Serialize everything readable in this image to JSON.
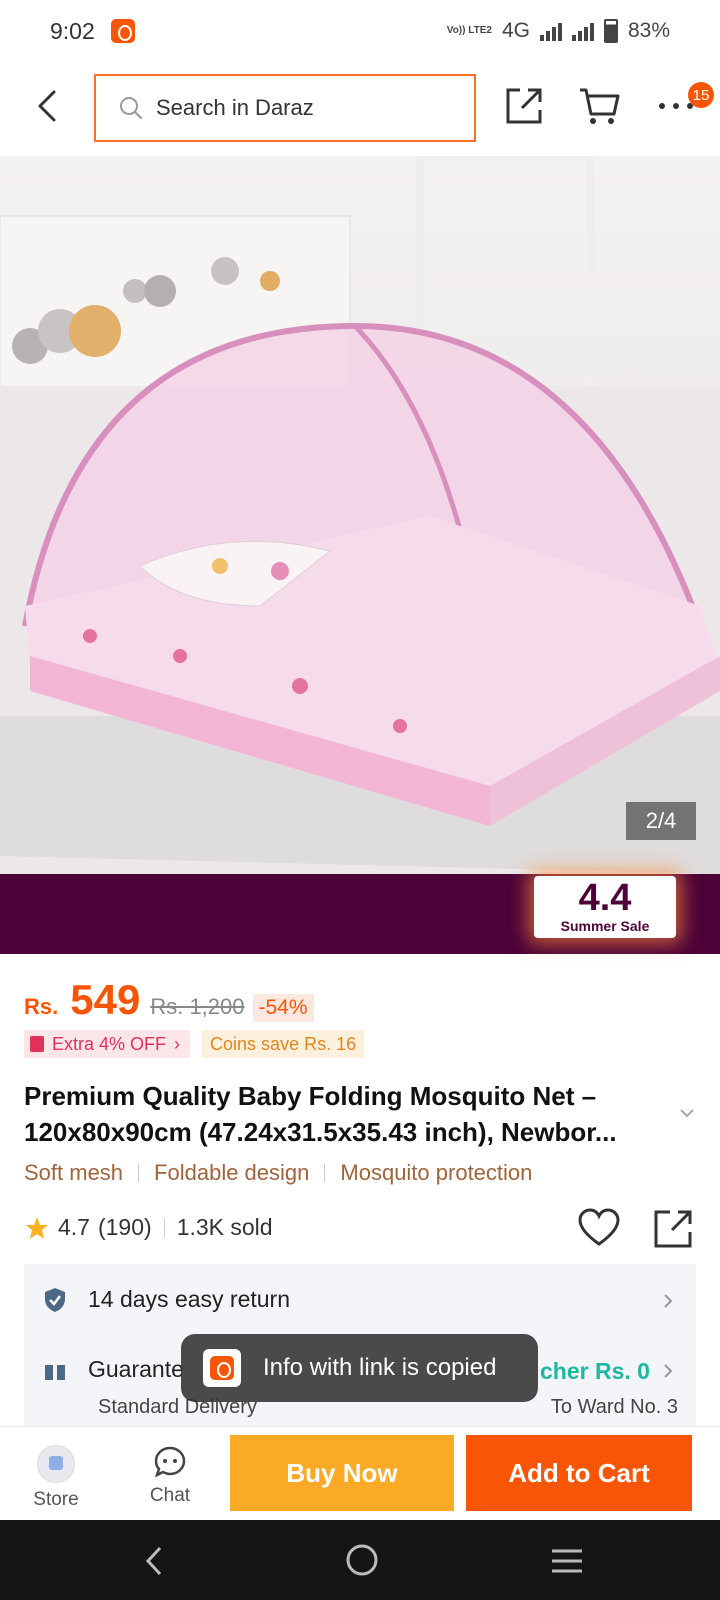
{
  "status_bar": {
    "time": "9:02",
    "volte_label": "Vo)) LTE2",
    "network": "4G",
    "battery": "83%"
  },
  "header": {
    "search_placeholder": "Search in Daraz",
    "cart_badge": "15",
    "icons": [
      "back-icon",
      "search-icon",
      "share-icon",
      "cart-icon",
      "more-icon"
    ]
  },
  "gallery": {
    "counter": "2/4"
  },
  "promo": {
    "sale_number": "4.4",
    "sale_text": "Summer Sale",
    "banner_color": "#4d0338"
  },
  "price": {
    "currency": "Rs.",
    "current": "549",
    "original": "Rs. 1,200",
    "discount": "-54%",
    "extra_off": "Extra 4% OFF",
    "coins": "Coins save Rs. 16"
  },
  "product": {
    "title": "Premium Quality Baby Folding Mosquito Net – 120x80x90cm (47.24x31.5x35.43 inch), Newbor...",
    "features": [
      "Soft mesh",
      "Foldable design",
      "Mosquito protection"
    ],
    "rating": "4.7",
    "review_count": "(190)",
    "sold": "1.3K sold"
  },
  "services": {
    "return_text": "14 days easy return",
    "guarantee_text": "Guarante",
    "voucher_text": "cher Rs. 0",
    "delivery_text": "Standard Delivery",
    "to_ward": "To Ward No. 3"
  },
  "toast": {
    "message": "Info with link is copied"
  },
  "action_bar": {
    "store_label": "Store",
    "chat_label": "Chat",
    "buy_now": "Buy Now",
    "add_to_cart": "Add to Cart"
  },
  "colors": {
    "accent": "#f85606",
    "buy_now": "#fbaa26",
    "voucher": "#1cb8a0"
  }
}
